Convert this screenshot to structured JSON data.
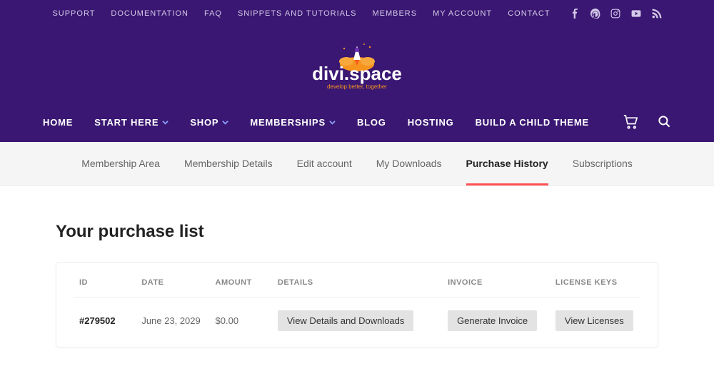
{
  "topbar": {
    "links": [
      "SUPPORT",
      "DOCUMENTATION",
      "FAQ",
      "SNIPPETS AND TUTORIALS",
      "MEMBERS",
      "MY ACCOUNT",
      "CONTACT"
    ]
  },
  "logo": {
    "brand_left": "divi",
    "brand_right": ".space",
    "tagline": "develop better, together"
  },
  "mainnav": {
    "items": [
      {
        "label": "HOME",
        "dropdown": false
      },
      {
        "label": "START HERE",
        "dropdown": true
      },
      {
        "label": "SHOP",
        "dropdown": true
      },
      {
        "label": "MEMBERSHIPS",
        "dropdown": true
      },
      {
        "label": "BLOG",
        "dropdown": false
      },
      {
        "label": "HOSTING",
        "dropdown": false
      },
      {
        "label": "BUILD A CHILD THEME",
        "dropdown": false
      }
    ]
  },
  "subnav": {
    "items": [
      "Membership Area",
      "Membership Details",
      "Edit account",
      "My Downloads",
      "Purchase History",
      "Subscriptions"
    ],
    "active_index": 4
  },
  "page": {
    "title": "Your purchase list"
  },
  "table": {
    "headers": [
      "ID",
      "DATE",
      "AMOUNT",
      "DETAILS",
      "INVOICE",
      "LICENSE KEYS"
    ],
    "row": {
      "id": "#279502",
      "date": "June 23, 2029",
      "amount": "$0.00",
      "details_btn": "View Details and Downloads",
      "invoice_btn": "Generate Invoice",
      "license_btn": "View Licenses"
    }
  }
}
